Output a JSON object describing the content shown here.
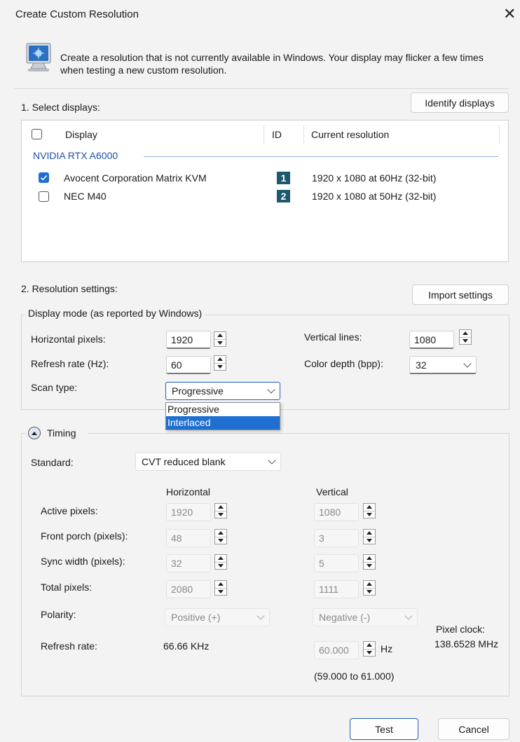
{
  "window": {
    "title": "Create Custom Resolution"
  },
  "intro": {
    "text": "Create a resolution that is not currently available in Windows. Your display may flicker a few times when testing a new custom resolution."
  },
  "displays": {
    "section_label": "1. Select displays:",
    "identify_button": "Identify displays",
    "columns": {
      "display": "Display",
      "id": "ID",
      "current_resolution": "Current resolution"
    },
    "group": "NVIDIA RTX A6000",
    "rows": [
      {
        "name": "Avocent Corporation Matrix KVM",
        "id": "1",
        "resolution": "1920 x 1080 at 60Hz (32-bit)",
        "checked": true
      },
      {
        "name": "NEC M40",
        "id": "2",
        "resolution": "1920 x 1080 at 50Hz (32-bit)",
        "checked": false
      }
    ]
  },
  "settings": {
    "section_label": "2. Resolution settings:",
    "import_button": "Import settings",
    "display_mode_legend": "Display mode (as reported by Windows)",
    "horizontal_pixels": {
      "label": "Horizontal pixels:",
      "value": "1920"
    },
    "vertical_lines": {
      "label": "Vertical lines:",
      "value": "1080"
    },
    "refresh_rate": {
      "label": "Refresh rate (Hz):",
      "value": "60"
    },
    "color_depth": {
      "label": "Color depth (bpp):",
      "value": "32"
    },
    "scan_type": {
      "label": "Scan type:",
      "value": "Progressive",
      "options": [
        "Progressive",
        "Interlaced"
      ],
      "highlighted": "Interlaced"
    }
  },
  "timing": {
    "toggle_label": "Timing",
    "standard_label": "Standard:",
    "standard_value": "CVT reduced blank",
    "horizontal_header": "Horizontal",
    "vertical_header": "Vertical",
    "active_pixels": {
      "label": "Active pixels:",
      "h": "1920",
      "v": "1080"
    },
    "front_porch": {
      "label": "Front porch (pixels):",
      "h": "48",
      "v": "3"
    },
    "sync_width": {
      "label": "Sync width (pixels):",
      "h": "32",
      "v": "5"
    },
    "total_pixels": {
      "label": "Total pixels:",
      "h": "2080",
      "v": "1111"
    },
    "polarity": {
      "label": "Polarity:",
      "h": "Positive (+)",
      "v": "Negative (-)"
    },
    "refresh_rate": {
      "label": "Refresh rate:",
      "h": "66.66 KHz",
      "v": "60.000",
      "unit": "Hz",
      "range": "(59.000 to 61.000)"
    },
    "pixel_clock": {
      "label": "Pixel clock:",
      "value": "138.6528 MHz"
    }
  },
  "buttons": {
    "test": "Test",
    "cancel": "Cancel"
  }
}
